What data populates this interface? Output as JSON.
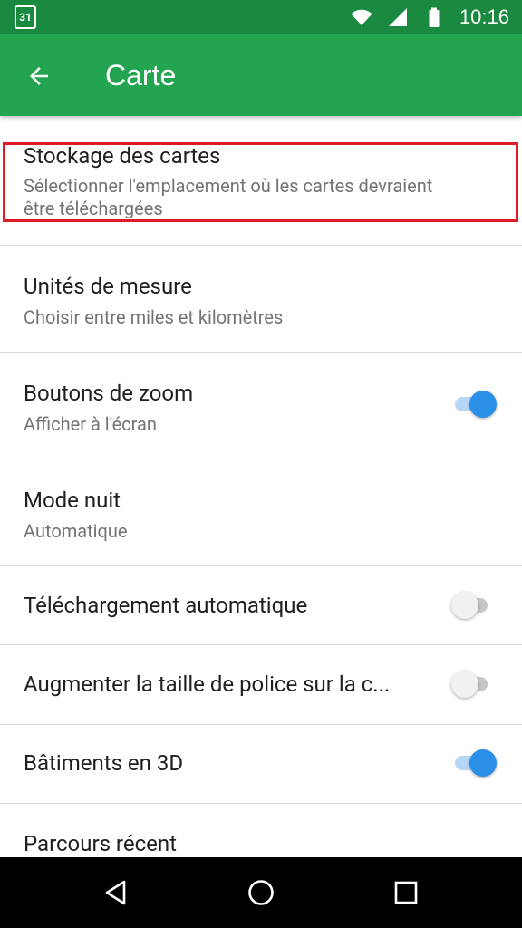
{
  "status_bar": {
    "calendar_day": "31",
    "time": "10:16",
    "icons": [
      "calendar-icon",
      "wifi-icon",
      "signal-icon",
      "battery-icon"
    ]
  },
  "toolbar": {
    "title": "Carte",
    "back_icon": "arrow-back-icon"
  },
  "settings": {
    "storage": {
      "title": "Stockage des cartes",
      "subtitle_line1": "Sélectionner l'emplacement où les cartes devraient",
      "subtitle_line2": "être téléchargées"
    },
    "units": {
      "title": "Unités de mesure",
      "subtitle": "Choisir entre miles et kilomètres"
    },
    "zoom_buttons": {
      "title": "Boutons de zoom",
      "subtitle": "Afficher à l'écran",
      "enabled": true
    },
    "night_mode": {
      "title": "Mode nuit",
      "subtitle": "Automatique"
    },
    "auto_download": {
      "title": "Téléchargement automatique",
      "enabled": false
    },
    "font_size": {
      "title": "Augmenter la taille de police sur la c...",
      "enabled": false
    },
    "buildings_3d": {
      "title": "Bâtiments en 3D",
      "enabled": true
    },
    "recent_route": {
      "title": "Parcours récent"
    }
  },
  "colors": {
    "status_bar": "#1b8a41",
    "toolbar": "#23a451",
    "switch_on": "#2a8fe6",
    "highlight": "#e01a27"
  },
  "nav_bar": {
    "icons": [
      "back-triangle-icon",
      "home-circle-icon",
      "recents-square-icon"
    ]
  }
}
